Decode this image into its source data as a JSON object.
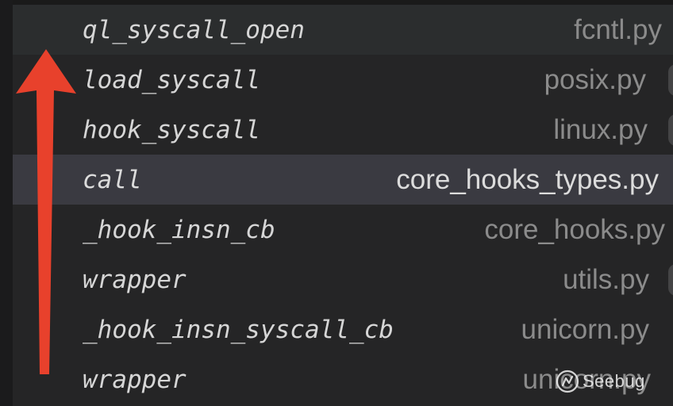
{
  "call_stack": {
    "frames": [
      {
        "function": "ql_syscall_open",
        "file": "fcntl.py"
      },
      {
        "function": "load_syscall",
        "file": "posix.py"
      },
      {
        "function": "hook_syscall",
        "file": "linux.py"
      },
      {
        "function": "call",
        "file": "core_hooks_types.py"
      },
      {
        "function": "_hook_insn_cb",
        "file": "core_hooks.py"
      },
      {
        "function": "wrapper",
        "file": "utils.py"
      },
      {
        "function": "_hook_insn_syscall_cb",
        "file": "unicorn.py"
      },
      {
        "function": "wrapper",
        "file": "unicorn.py"
      }
    ],
    "selected_index": 3
  },
  "annotation": {
    "arrow_color": "#e8412c",
    "arrow_direction": "up"
  },
  "watermark": {
    "text": "Seebug",
    "icon": "seebug-logo-icon"
  },
  "colors": {
    "background": "#252526",
    "selected_row": "#3a3a41",
    "function_text": "#d6d6d6",
    "file_text": "#8b8b8b"
  }
}
